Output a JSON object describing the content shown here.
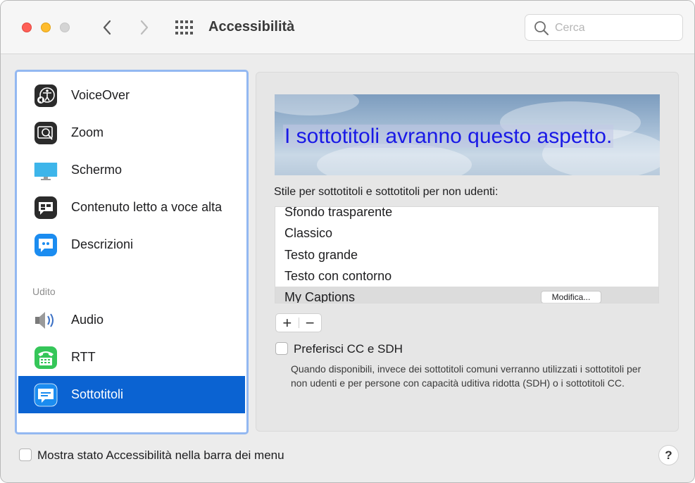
{
  "window": {
    "title": "Accessibilità"
  },
  "search": {
    "placeholder": "Cerca"
  },
  "sidebar": {
    "vision_items": [
      {
        "label": "VoiceOver",
        "icon": "voiceover-icon"
      },
      {
        "label": "Zoom",
        "icon": "zoom-icon"
      },
      {
        "label": "Schermo",
        "icon": "display-icon"
      },
      {
        "label": "Contenuto letto a voce alta",
        "icon": "spoken-content-icon"
      },
      {
        "label": "Descrizioni",
        "icon": "descriptions-icon"
      }
    ],
    "hearing_header": "Udito",
    "hearing_items": [
      {
        "label": "Audio",
        "icon": "speaker-icon"
      },
      {
        "label": "RTT",
        "icon": "rtt-phone-icon"
      },
      {
        "label": "Sottotitoli",
        "icon": "captions-icon",
        "selected": true
      }
    ]
  },
  "captions": {
    "preview_text": "I sottotitoli avranno questo aspetto.",
    "style_label": "Stile per sottotitoli e sottotitoli per non udenti:",
    "styles": [
      "Sfondo trasparente",
      "Classico",
      "Testo grande",
      "Testo con contorno",
      "My Captions"
    ],
    "selected_style": "My Captions",
    "edit_button": "Modifica...",
    "add_symbol": "+",
    "remove_symbol": "−",
    "prefer_cc_label": "Preferisci CC e SDH",
    "prefer_cc_checked": false,
    "prefer_cc_description": "Quando disponibili, invece dei sottotitoli comuni verranno utilizzati i sottotitoli per non udenti e per persone con capacità uditiva ridotta (SDH) o i sottotitoli CC."
  },
  "footer": {
    "menu_status_label": "Mostra stato Accessibilità nella barra dei menu",
    "menu_status_checked": false,
    "help_symbol": "?"
  },
  "colors": {
    "selection": "#0b63d2",
    "sidebar_focus_ring": "#93b8f1",
    "preview_text": "#1919e6"
  }
}
